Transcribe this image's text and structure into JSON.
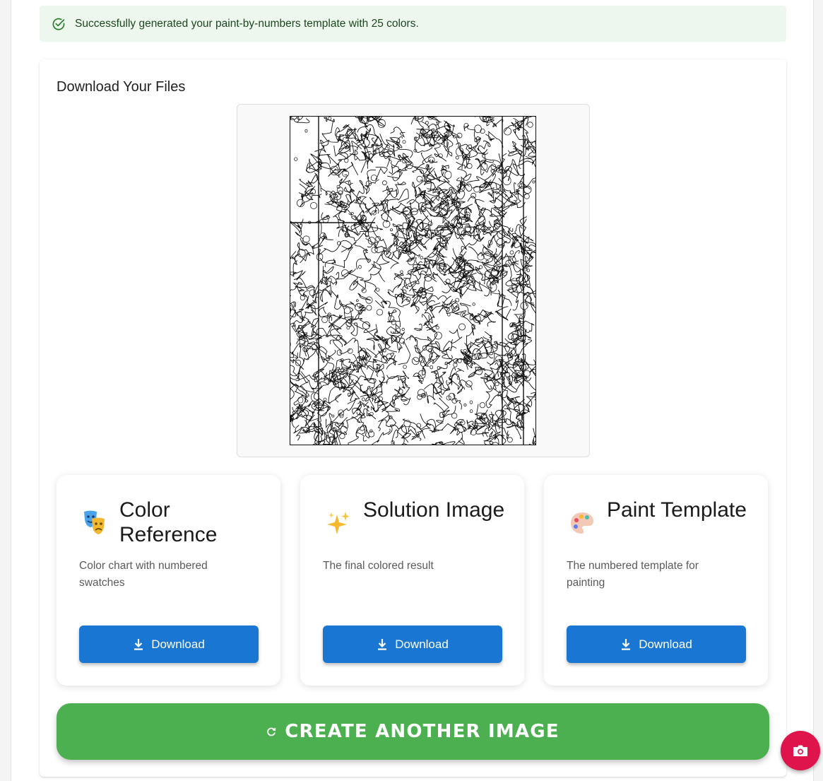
{
  "alert": {
    "message": "Successfully generated your paint-by-numbers template with 25 colors.",
    "icon": "check-circle-icon",
    "color": "#edf7ed"
  },
  "downloads": {
    "title": "Download Your Files",
    "preview_icon": "line-art-template-preview",
    "cards": [
      {
        "title": "Color Reference",
        "description": "Color chart with numbered swatches",
        "icon": "theater-masks-emoji",
        "button_label": "Download"
      },
      {
        "title": "Solution Image",
        "description": "The final colored result",
        "icon": "sparkles-emoji",
        "button_label": "Download"
      },
      {
        "title": "Paint Template",
        "description": "The numbered template for painting",
        "icon": "artist-palette-emoji",
        "button_label": "Download"
      }
    ]
  },
  "create_button": {
    "label": "CREATE ANOTHER IMAGE",
    "icon": "refresh-icon",
    "color": "#4caf50"
  },
  "fab": {
    "icon": "camera-icon",
    "color": "#e0144c"
  },
  "colors": {
    "primary": "#1976d2",
    "success": "#4caf50",
    "accent": "#e0144c"
  }
}
